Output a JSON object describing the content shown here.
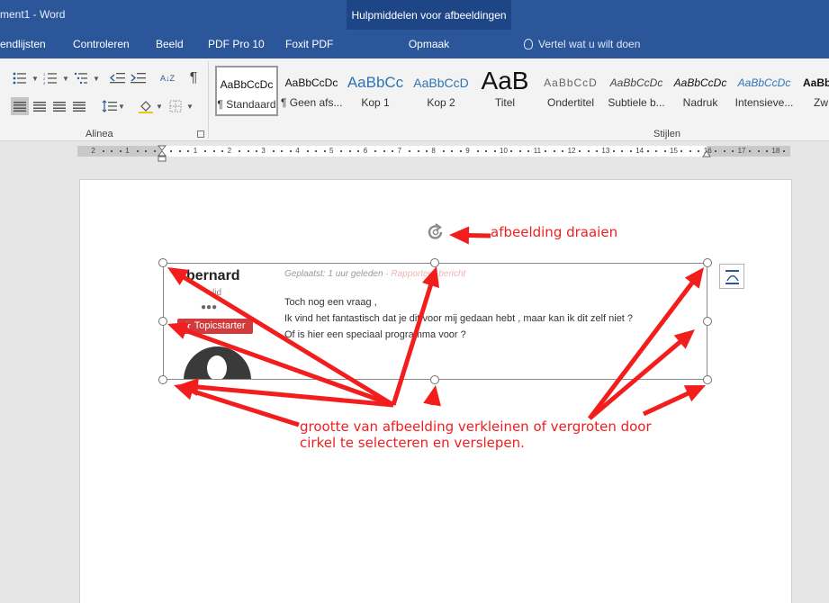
{
  "titlebar": {
    "doc_title": "ment1  -  Word",
    "contextual_title": "Hulpmiddelen voor afbeeldingen"
  },
  "tabs": [
    "endlijsten",
    "Controleren",
    "Beeld",
    "PDF Pro 10",
    "Foxit PDF"
  ],
  "contextual_tab": "Opmaak",
  "tell_me": "Vertel wat u wilt doen",
  "ribbon": {
    "alinea_label": "Alinea",
    "stijlen_label": "Stijlen",
    "pilcrow": "¶",
    "sort_label": "A↓Z",
    "styles": [
      {
        "sample": "AaBbCcDc",
        "name": "¶ Standaard",
        "selected": true
      },
      {
        "sample": "AaBbCcDc",
        "name": "¶ Geen afs...",
        "selected": false
      },
      {
        "sample": "AaBbCc",
        "name": "Kop 1",
        "selected": false
      },
      {
        "sample": "AaBbCcD",
        "name": "Kop 2",
        "selected": false
      },
      {
        "sample": "AaB",
        "name": "Titel",
        "selected": false
      },
      {
        "sample": "AaBbCcD",
        "name": "Ondertitel",
        "selected": false
      },
      {
        "sample": "AaBbCcDc",
        "name": "Subtiele b...",
        "selected": false
      },
      {
        "sample": "AaBbCcDc",
        "name": "Nadruk",
        "selected": false
      },
      {
        "sample": "AaBbCcDc",
        "name": "Intensieve...",
        "selected": false
      },
      {
        "sample": "AaBbC",
        "name": "Zw",
        "selected": false
      }
    ]
  },
  "ruler": {
    "labels": [
      "2",
      "1",
      "1",
      "2",
      "3",
      "4",
      "5",
      "6",
      "7",
      "8",
      "9",
      "10",
      "11",
      "12",
      "13",
      "14",
      "15",
      "16",
      "17",
      "18"
    ]
  },
  "picture": {
    "name": "bernard",
    "meta": "Geplaatst: 1 uur geleden · ",
    "report": "Rapporteer bericht",
    "sub": "lid",
    "dots": "●●●",
    "badge": "Topicstarter",
    "lines": [
      "Toch nog een vraag ,",
      "Ik vind het fantastisch dat je dit voor mij gedaan hebt , maar kan ik dit zelf niet ?",
      "Of is hier een speciaal programma voor ?"
    ]
  },
  "annotations": {
    "rotate": "afbeelding draaien",
    "resize_line1": "grootte van afbeelding verkleinen of vergroten door",
    "resize_line2": "cirkel te selecteren en verslepen."
  },
  "colors": {
    "word_blue": "#2b579a",
    "contextual_blue": "#1e4686",
    "annotation_red": "#f21e1e",
    "badge_red": "#d23b3b"
  },
  "icons": [
    "bulleted-list-icon",
    "numbered-list-icon",
    "multilevel-list-icon",
    "decrease-indent-icon",
    "increase-indent-icon",
    "sort-icon",
    "pilcrow-icon",
    "align-left-icon",
    "align-center-icon",
    "align-right-icon",
    "justify-icon",
    "line-spacing-icon",
    "shading-icon",
    "borders-icon",
    "lightbulb-icon",
    "rotate-icon",
    "layout-options-icon",
    "star-icon"
  ]
}
